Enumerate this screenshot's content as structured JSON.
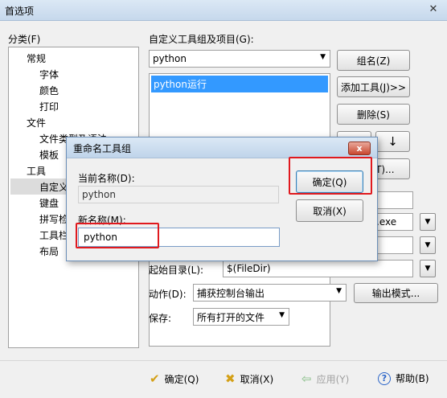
{
  "window": {
    "title": "首选项",
    "close_glyph": "✕"
  },
  "category": {
    "label": "分类(F)",
    "items": [
      {
        "label": "常规",
        "level": 1
      },
      {
        "label": "字体",
        "level": 2
      },
      {
        "label": "颜色",
        "level": 2
      },
      {
        "label": "打印",
        "level": 2
      },
      {
        "label": "文件",
        "level": 1
      },
      {
        "label": "文件类型及语法",
        "level": 2
      },
      {
        "label": "模板",
        "level": 2
      },
      {
        "label": "工具",
        "level": 1
      },
      {
        "label": "自定义工具",
        "level": 2
      },
      {
        "label": "键盘",
        "level": 2
      },
      {
        "label": "拼写检查",
        "level": 2
      },
      {
        "label": "工具栏",
        "level": 2
      },
      {
        "label": "布局",
        "level": 2
      }
    ]
  },
  "tools": {
    "group_label": "自定义工具组及项目(G):",
    "group_value": "python",
    "list_items": [
      "python运行"
    ],
    "buttons": {
      "group_name": "组名(Z)",
      "add_tool": "添加工具(J)>>",
      "delete": "删除(S)",
      "down_arrow": "↓",
      "icon": "图标(T)..."
    },
    "command_suffix": ".exe",
    "start_dir_label": "起始目录(L):",
    "start_dir_value": "$(FileDir)",
    "action_label": "动作(D):",
    "action_value": "捕获控制台输出",
    "output_mode": "输出模式...",
    "save_label": "保存:",
    "save_value": "所有打开的文件"
  },
  "footer": {
    "ok": "确定(Q)",
    "cancel": "取消(X)",
    "apply": "应用(Y)",
    "help": "帮助(B)",
    "colors": {
      "ok": "#d4a017",
      "cancel": "#d4a017",
      "apply": "#9cc89c",
      "help": "#2a64c8"
    }
  },
  "dialog": {
    "title": "重命名工具组",
    "close_glyph": "x",
    "current_label": "当前名称(D):",
    "current_value": "python",
    "new_label": "新名称(M):",
    "new_value": "python",
    "ok": "确定(Q)",
    "cancel": "取消(X)",
    "highlight_color": "#e0191e"
  }
}
